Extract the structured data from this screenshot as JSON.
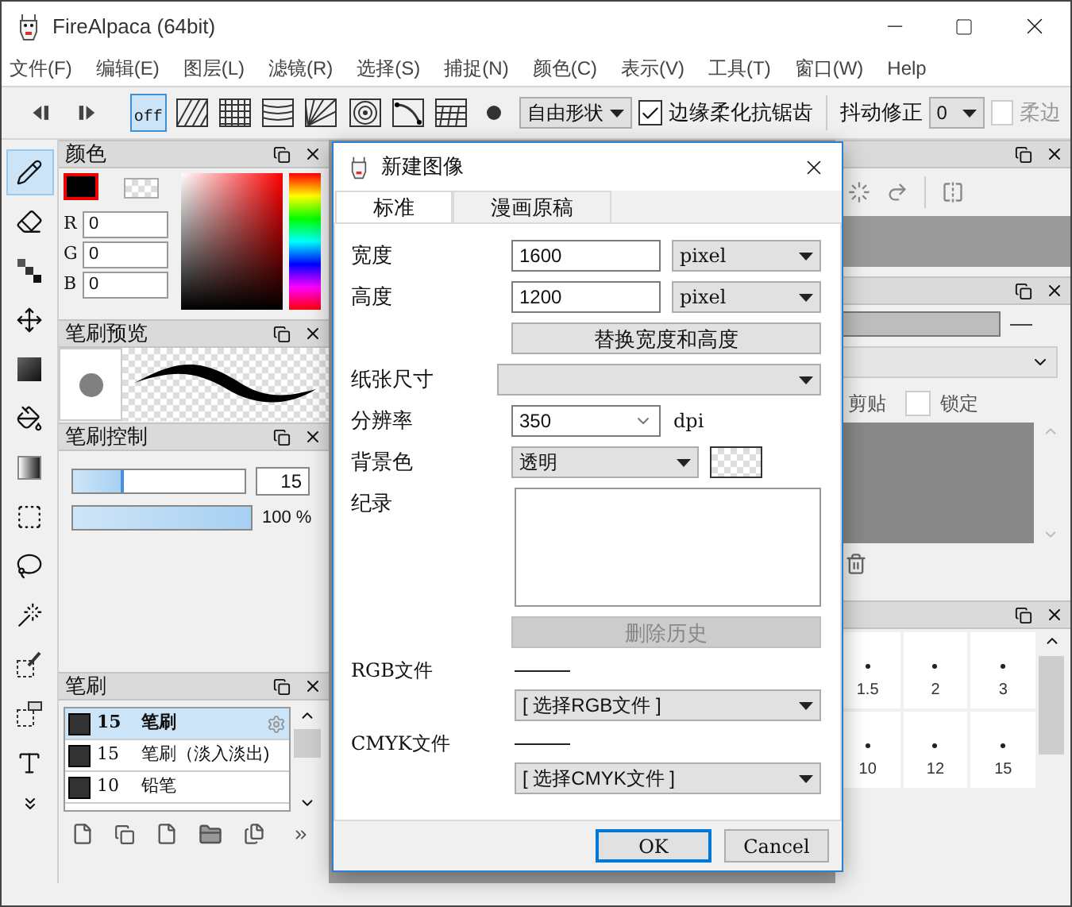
{
  "window": {
    "title": "FireAlpaca (64bit)"
  },
  "menu": [
    "文件(F)",
    "编辑(E)",
    "图层(L)",
    "滤镜(R)",
    "选择(S)",
    "捕捉(N)",
    "颜色(C)",
    "表示(V)",
    "工具(T)",
    "窗口(W)",
    "Help"
  ],
  "toolbar": {
    "patterns": [
      {
        "kind": "off",
        "label": "off",
        "selected": true
      },
      {
        "kind": "diagonal",
        "selected": false
      },
      {
        "kind": "grid",
        "selected": false
      },
      {
        "kind": "curves",
        "selected": false
      },
      {
        "kind": "radial",
        "selected": false
      },
      {
        "kind": "circles",
        "selected": false
      },
      {
        "kind": "curve",
        "selected": false
      },
      {
        "kind": "perspective",
        "selected": false
      },
      {
        "kind": "dot",
        "selected": false
      }
    ],
    "shape": "自由形状",
    "antialias": {
      "label": "边缘柔化抗锯齿",
      "checked": true
    },
    "stabilizer_label": "抖动修正",
    "stabilizer_value": "0",
    "soft_edge": {
      "label": "柔边",
      "checked": false,
      "disabled": true
    }
  },
  "tools": [
    {
      "kind": "pen",
      "selected": true
    },
    {
      "kind": "eraser",
      "selected": false
    },
    {
      "kind": "dots",
      "selected": false
    },
    {
      "kind": "move",
      "selected": false
    },
    {
      "kind": "fill",
      "selected": false
    },
    {
      "kind": "bucket",
      "selected": false
    },
    {
      "kind": "gradient",
      "selected": false
    },
    {
      "kind": "select",
      "selected": false
    },
    {
      "kind": "lasso",
      "selected": false
    },
    {
      "kind": "wand",
      "selected": false
    },
    {
      "kind": "selpen",
      "selected": false
    },
    {
      "kind": "selerase",
      "selected": false
    },
    {
      "kind": "text",
      "selected": false
    },
    {
      "kind": "more",
      "selected": false
    }
  ],
  "color_panel": {
    "title": "颜色",
    "channels": [
      {
        "label": "R",
        "value": "0"
      },
      {
        "label": "G",
        "value": "0"
      },
      {
        "label": "B",
        "value": "0"
      }
    ]
  },
  "brush_preview": {
    "title": "笔刷预览"
  },
  "brush_control": {
    "title": "笔刷控制",
    "size": {
      "level": 0.3,
      "value": "15"
    },
    "opacity": {
      "level": 1,
      "value": "100 %"
    }
  },
  "brush_panel": {
    "title": "笔刷",
    "items": [
      {
        "size": "15",
        "name": "笔刷",
        "selected": true
      },
      {
        "size": "15",
        "name": "笔刷（淡入淡出)",
        "selected": false
      },
      {
        "size": "10",
        "name": "铅笔",
        "selected": false
      }
    ]
  },
  "layer_panel": {
    "clip_label": "剪贴",
    "lock": {
      "label": "锁定",
      "checked": false
    }
  },
  "brush_sizes": [
    {
      "label": "1.5"
    },
    {
      "label": "2"
    },
    {
      "label": "3"
    },
    {
      "label": "10"
    },
    {
      "label": "12"
    },
    {
      "label": "15"
    }
  ],
  "dialog": {
    "title": "新建图像",
    "tabs": [
      {
        "label": "标准",
        "selected": true
      },
      {
        "label": "漫画原稿",
        "selected": false
      }
    ],
    "width": {
      "label": "宽度",
      "value": "1600",
      "unit": "pixel"
    },
    "height": {
      "label": "高度",
      "value": "1200",
      "unit": "pixel"
    },
    "swap_button": "替换宽度和高度",
    "paper_size": {
      "label": "纸张尺寸"
    },
    "resolution": {
      "label": "分辨率",
      "value": "350",
      "unit": "dpi"
    },
    "background": {
      "label": "背景色",
      "value": "透明"
    },
    "notes": {
      "label": "纪录"
    },
    "delete_history": {
      "label": "删除历史",
      "disabled": true
    },
    "rgb": {
      "label": "RGB文件",
      "value": "[ 选择RGB文件 ]"
    },
    "cmyk": {
      "label": "CMYK文件",
      "value": "[ 选择CMYK文件 ]"
    },
    "ok": "OK",
    "cancel": "Cancel"
  }
}
